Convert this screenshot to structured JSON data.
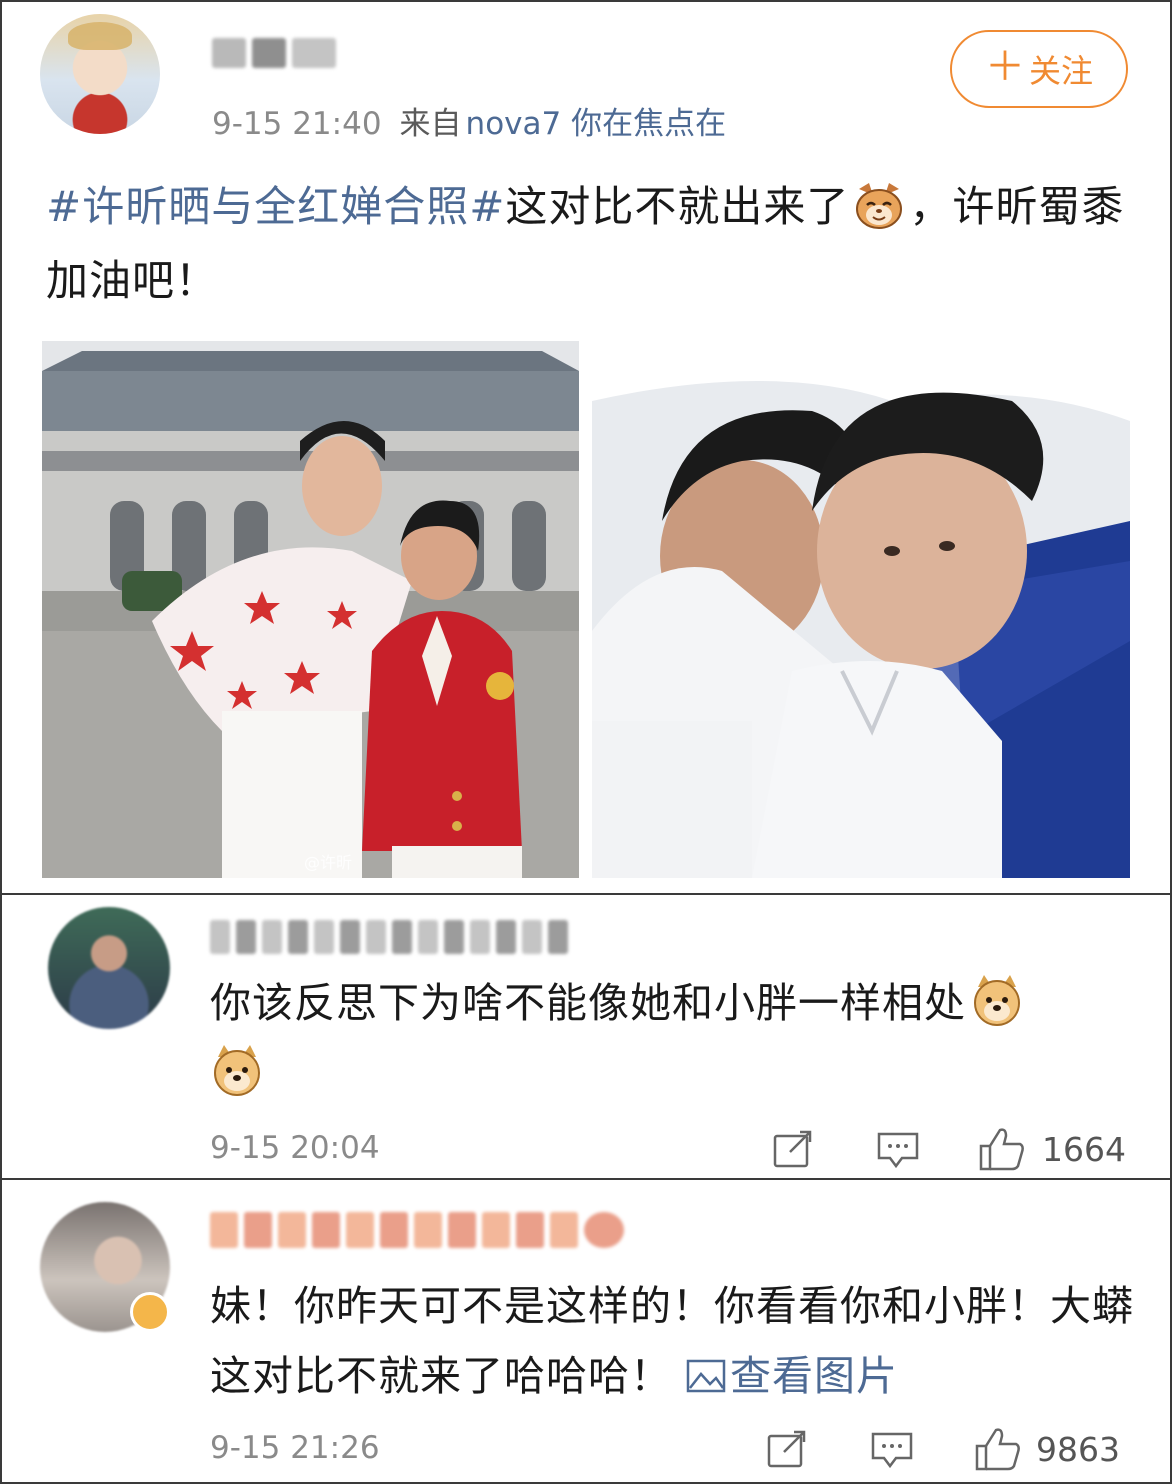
{
  "post": {
    "name_blurred": "",
    "time": "9-15 21:40",
    "source_prefix": "来自",
    "source_device": "nova7 你在焦点在",
    "follow_label": "关注",
    "follow_plus": "＋",
    "hashtag": "#许昕晒与全红婵合照#",
    "text_a": "这对比不就出来了",
    "text_b": "，许昕蜀黍加油吧！",
    "photo1_watermark": "@许昕"
  },
  "comments": [
    {
      "text": "你该反思下为啥不能像她和小胖一样相处",
      "time": "9-15 20:04",
      "likes": "1664"
    },
    {
      "text": "妹！你昨天可不是这样的！你看看你和小胖！大蟒这对比不就来了哈哈哈！ ",
      "link": "查看图片",
      "time": "9-15 21:26",
      "likes": "9863"
    }
  ],
  "colors": {
    "accent_orange": "#f08a32",
    "link_blue": "#4d6a94",
    "meta_gray": "#8a8a8a"
  },
  "icons": [
    "repost-icon",
    "comment-icon",
    "like-icon",
    "image-link-icon"
  ]
}
